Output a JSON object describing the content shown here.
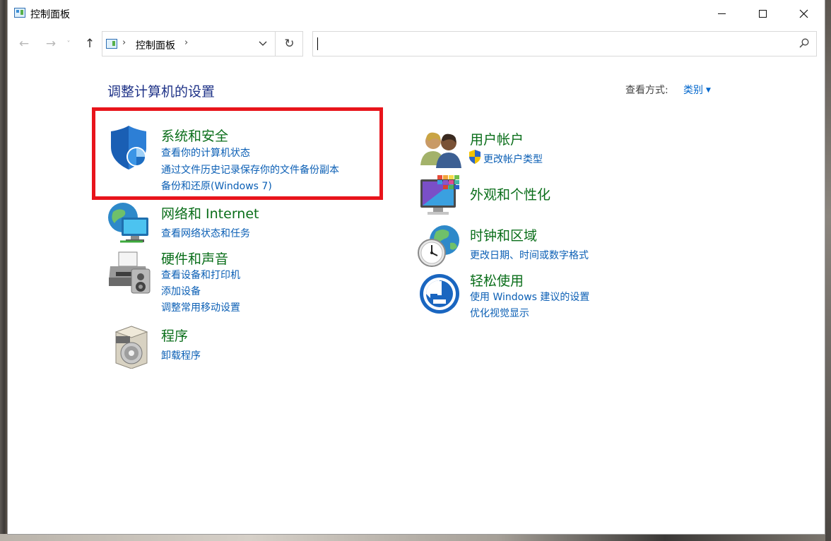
{
  "window": {
    "title": "控制面板"
  },
  "nav": {
    "back": "←",
    "forward": "→",
    "recent": "˅",
    "up": "↑"
  },
  "address": {
    "sep1": "›",
    "crumb": "控制面板",
    "sep2": "›",
    "dropdown": "⌄",
    "refresh": "↻"
  },
  "search": {
    "placeholder": ""
  },
  "content": {
    "heading": "调整计算机的设置",
    "view_label": "查看方式:",
    "view_value": "类别"
  },
  "categories": {
    "system": {
      "icon": "shield-icon",
      "title": "系统和安全",
      "links": [
        "查看你的计算机状态",
        "通过文件历史记录保存你的文件备份副本",
        "备份和还原(Windows 7)"
      ]
    },
    "network": {
      "icon": "network-globe-icon",
      "title": "网络和 Internet",
      "links": [
        "查看网络状态和任务"
      ]
    },
    "hardware": {
      "icon": "printer-icon",
      "title": "硬件和声音",
      "links": [
        "查看设备和打印机",
        "添加设备",
        "调整常用移动设置"
      ]
    },
    "programs": {
      "icon": "programs-disc-icon",
      "title": "程序",
      "links": [
        "卸载程序"
      ]
    },
    "users": {
      "icon": "users-icon",
      "title": "用户帐户",
      "links": [
        "更改帐户类型"
      ]
    },
    "appearance": {
      "icon": "monitor-palette-icon",
      "title": "外观和个性化",
      "links": []
    },
    "clock": {
      "icon": "clock-globe-icon",
      "title": "时钟和区域",
      "links": [
        "更改日期、时间或数字格式"
      ]
    },
    "ease": {
      "icon": "ease-of-access-icon",
      "title": "轻松使用",
      "links": [
        "使用 Windows 建议的设置",
        "优化视觉显示"
      ]
    }
  },
  "colors": {
    "category_title": "#0a6e1a",
    "link": "#0b5fb5",
    "heading": "#1e3287",
    "highlight": "#e8141b"
  }
}
